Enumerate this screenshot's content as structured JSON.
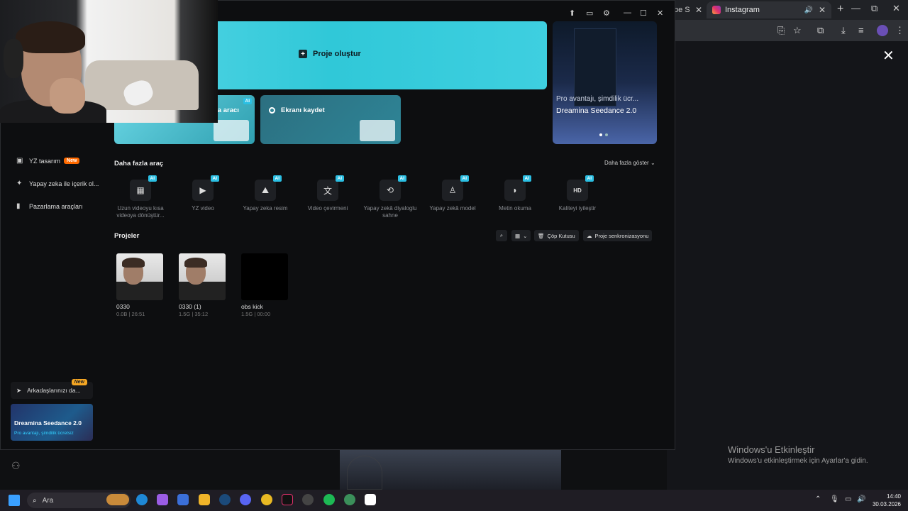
{
  "browser": {
    "prev_tab_label": "be S",
    "active_tab_label": "Instagram",
    "new_tab": "+",
    "min": "—",
    "max": "⧉",
    "close": "✕",
    "close_view": "✕"
  },
  "lower_notice": {
    "title": "Windows'u Etkinleştir",
    "subtitle": "Windows'u etkinleştirmek için Ayarlar'a gidin."
  },
  "app": {
    "sidebar": {
      "items": [
        {
          "label": "YZ tasarım",
          "badge": "New",
          "icon": "image-icon"
        },
        {
          "label": "Yapay zeka ile içerik ol...",
          "icon": "sparkle-icon"
        },
        {
          "label": "Pazarlama araçları",
          "icon": "bag-icon"
        }
      ],
      "invite": {
        "label": "Arkadaşlarınızı da...",
        "badge": "New"
      },
      "promo": {
        "title": "Dreamina Seedance 2.0",
        "subtitle": "Pro avantajı, şimdilik ücretsiz"
      }
    },
    "hero": {
      "create_label": "Proje oluştur"
    },
    "cards": [
      {
        "label": "na aracı",
        "badge": "AI"
      },
      {
        "label": "Ekranı kaydet"
      }
    ],
    "side_banner": {
      "line1": "Pro avantajı, şimdilik ücr...",
      "line2": "Dreamina Seedance 2.0"
    },
    "tools_section": {
      "title": "Daha fazla araç",
      "show_more": "Daha fazla göster"
    },
    "tools": [
      {
        "label": "Uzun videoyu kısa videoya dönüştür...",
        "icon": "film-icon",
        "badge": "AI"
      },
      {
        "label": "YZ video",
        "icon": "video-plus-icon",
        "badge": "AI"
      },
      {
        "label": "Yapay zeka resim",
        "icon": "image-plus-icon",
        "badge": "AI"
      },
      {
        "label": "Video çevirmeni",
        "icon": "translate-icon",
        "badge": "AI"
      },
      {
        "label": "Yapay zekâ diyaloglu sahne",
        "icon": "dialogue-icon",
        "badge": "AI"
      },
      {
        "label": "Yapay zekâ model",
        "icon": "shirt-icon",
        "badge": "AI"
      },
      {
        "label": "Metin okuma",
        "icon": "speech-icon",
        "badge": "AI"
      },
      {
        "label": "Kaliteyi iyileştir",
        "icon": "hd-icon",
        "badge": "AI"
      }
    ],
    "projects_section": {
      "title": "Projeler",
      "trash": "Çöp Kutusu",
      "sync": "Proje senkronizasyonu"
    },
    "projects": [
      {
        "name": "0330",
        "meta": "0.0B | 26:51",
        "thumb": "person"
      },
      {
        "name": "0330 (1)",
        "meta": "1.5G | 35:12",
        "thumb": "person"
      },
      {
        "name": "obs kick",
        "meta": "1.5G | 00:00",
        "thumb": "black"
      }
    ]
  },
  "taskbar": {
    "search_placeholder": "Ara",
    "time": "14:40",
    "date": "30.03.2026"
  }
}
